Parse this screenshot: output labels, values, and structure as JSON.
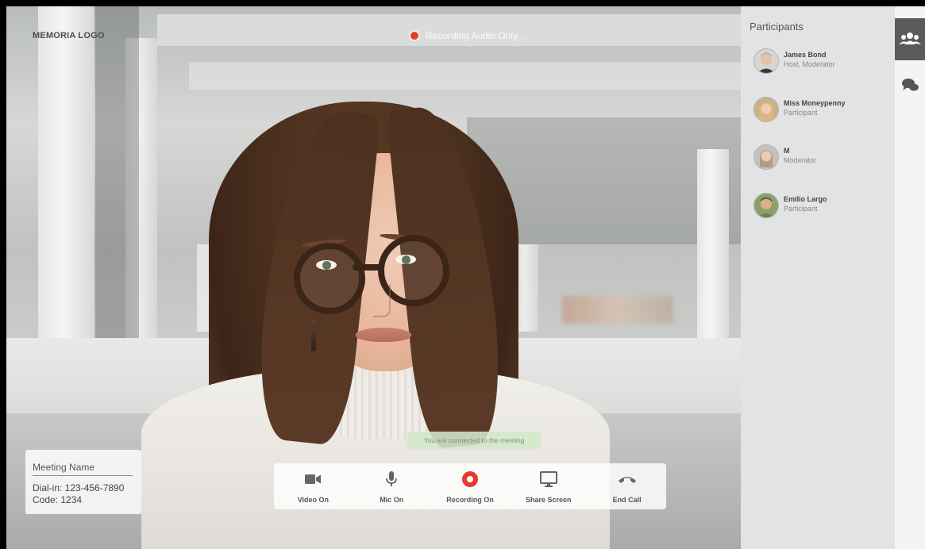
{
  "header": {
    "logo_text": "MEMORIA LOGO",
    "recording_status": "Recording Audio Only..."
  },
  "meeting": {
    "name": "Meeting Name",
    "dial_in": "Dial-in: 123-456-7890",
    "code": "Code: 1234"
  },
  "toast": "You are connected to the meeting",
  "toolbar": {
    "buttons": [
      {
        "label": "Video On",
        "icon": "video-camera-icon"
      },
      {
        "label": "Mic On",
        "icon": "microphone-icon"
      },
      {
        "label": "Recording On",
        "icon": "record-icon"
      },
      {
        "label": "Share Screen",
        "icon": "monitor-icon"
      },
      {
        "label": "End Call",
        "icon": "phone-hangup-icon"
      }
    ]
  },
  "participants": {
    "title": "Participants",
    "list": [
      {
        "name": "James Bond",
        "role": "Host, Moderator"
      },
      {
        "name": "Miss Moneypenny",
        "role": "Participant"
      },
      {
        "name": "M",
        "role": "Moderator"
      },
      {
        "name": "Emilio Largo",
        "role": "Participant"
      }
    ]
  },
  "rail": {
    "tabs": [
      {
        "icon": "people-icon",
        "active": true
      },
      {
        "icon": "chat-icon",
        "active": false
      }
    ]
  },
  "colors": {
    "record_red": "#e8392f",
    "panel_bg": "#e2e3e5",
    "toast_bg": "#d1e8c8",
    "rail_active": "#5a5a5a"
  }
}
